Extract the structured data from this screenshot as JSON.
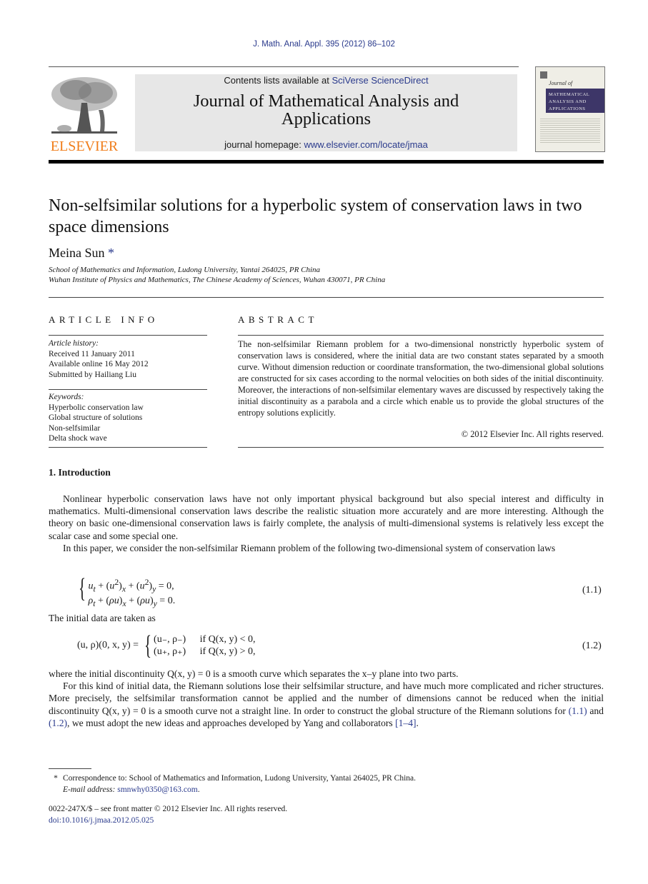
{
  "citation": "J. Math. Anal. Appl. 395 (2012) 86–102",
  "header": {
    "publisher_wordmark": "ELSEVIER",
    "contents_prefix": "Contents lists available at ",
    "contents_link": "SciVerse ScienceDirect",
    "journal_title_line1": "Journal of Mathematical Analysis and",
    "journal_title_line2": "Applications",
    "homepage_prefix": "journal homepage: ",
    "homepage_link": "www.elsevier.com/locate/jmaa",
    "cover": {
      "journal_of": "Journal of",
      "line1": "MATHEMATICAL",
      "line2": "ANALYSIS AND",
      "line3": "APPLICATIONS"
    }
  },
  "article": {
    "title": "Non-selfsimilar solutions for a hyperbolic system of conservation laws in two space dimensions",
    "author": "Meina Sun",
    "author_mark": "*",
    "affiliations": [
      "School of Mathematics and Information, Ludong University, Yantai 264025, PR China",
      "Wuhan Institute of Physics and Mathematics, The Chinese Academy of Sciences, Wuhan 430071, PR China"
    ]
  },
  "article_info": {
    "heading": "ARTICLE INFO",
    "history_label": "Article history:",
    "history": [
      "Received 11 January 2011",
      "Available online 16 May 2012",
      "Submitted by Hailiang Liu"
    ],
    "keywords_label": "Keywords:",
    "keywords": [
      "Hyperbolic conservation law",
      "Global structure of solutions",
      "Non-selfsimilar",
      "Delta shock wave"
    ]
  },
  "abstract": {
    "heading": "ABSTRACT",
    "text": "The non-selfsimilar Riemann problem for a two-dimensional nonstrictly hyperbolic system of conservation laws is considered, where the initial data are two constant states separated by a smooth curve. Without dimension reduction or coordinate transformation, the two-dimensional global solutions are constructed for six cases according to the normal velocities on both sides of the initial discontinuity. Moreover, the interactions of non-selfsimilar elementary waves are discussed by respectively taking the initial discontinuity as a parabola and a circle which enable us to provide the global structures of the entropy solutions explicitly.",
    "copyright": "© 2012 Elsevier Inc. All rights reserved."
  },
  "intro": {
    "heading": "1. Introduction",
    "paragraphs": [
      "Nonlinear hyperbolic conservation laws have not only important physical background but also special interest and difficulty in mathematics. Multi-dimensional conservation laws describe the realistic situation more accurately and are more interesting. Although the theory on basic one-dimensional conservation laws is fairly complete, the analysis of multi-dimensional systems is relatively less except the scalar case and some special one.",
      "In this paper, we consider the non-selfsimilar Riemann problem of the following two-dimensional system of conservation laws"
    ],
    "eq11": {
      "line1": "u_t + (u²)_x + (u²)_y = 0,",
      "line2": "ρ_t + (ρu)_x + (ρu)_y = 0.",
      "number": "(1.1)"
    },
    "initial_data_line": "The initial data are taken as",
    "eq12": {
      "lhs": "(u, ρ)(0, x, y) =",
      "case1_value": "(u₋, ρ₋)",
      "case1_cond": "if Q(x, y) < 0,",
      "case2_value": "(u₊, ρ₊)",
      "case2_cond": "if Q(x, y) > 0,",
      "number": "(1.2)"
    },
    "after_eq_1": "where the initial discontinuity Q(x, y) = 0 is a smooth curve which separates the x–y plane into two parts.",
    "after_eq_2_part1": "For this kind of initial data, the Riemann solutions lose their selfsimilar structure, and have much more complicated and richer structures. More precisely, the selfsimilar transformation cannot be applied and the number of dimensions cannot be reduced when the initial discontinuity Q(x, y) = 0 is a smooth curve not a straight line. In order to construct the global structure of the Riemann solutions for ",
    "ref_eq11": "(1.1)",
    "and_word": " and ",
    "ref_eq12": "(1.2)",
    "after_eq_2_part2": ", we must adopt the new ideas and approaches developed by Yang and collaborators ",
    "ref_cite": "[1–4]",
    "after_eq_2_end": "."
  },
  "footnote": {
    "star": "*",
    "correspondence": "Correspondence to: School of Mathematics and Information, Ludong University, Yantai 264025, PR China.",
    "email_label": "E-mail address: ",
    "email": "smnwhy0350@163.com",
    "email_end": "."
  },
  "issn_line": "0022-247X/$ – see front matter © 2012 Elsevier Inc. All rights reserved.",
  "doi": "doi:10.1016/j.jmaa.2012.05.025",
  "colors": {
    "link": "#2a3a8c",
    "elsevier_orange": "#f07d1a",
    "banner_gray": "#e7e7e7",
    "cover_band": "#3d3668"
  }
}
